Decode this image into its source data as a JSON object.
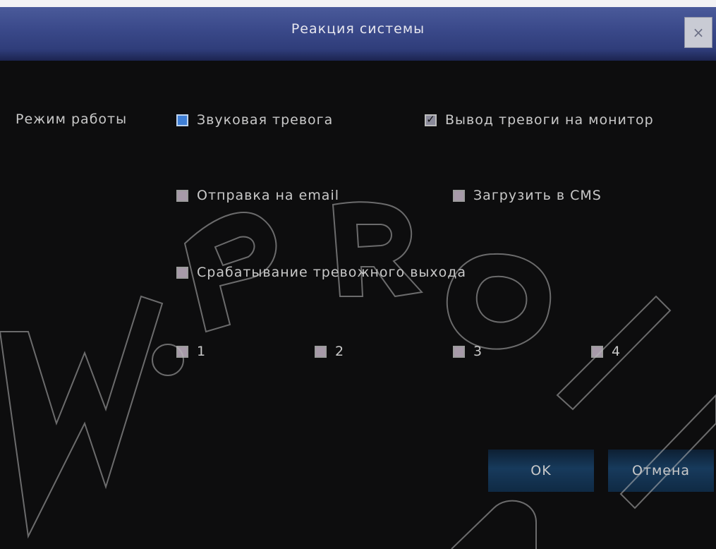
{
  "dialog": {
    "title": "Реакция системы",
    "close_symbol": "×",
    "mode_label": "Режим работы"
  },
  "options": {
    "sound_alarm": {
      "label": "Звуковая тревога",
      "checked": false
    },
    "monitor_output": {
      "label": "Вывод тревоги на монитор",
      "checked": true
    },
    "send_email": {
      "label": "Отправка на email",
      "checked": false
    },
    "upload_cms": {
      "label": "Загрузить в CMS",
      "checked": false
    },
    "alarm_output": {
      "label": "Срабатывание тревожного выхода",
      "checked": false
    }
  },
  "outputs": [
    "1",
    "2",
    "3",
    "4"
  ],
  "buttons": {
    "ok": "OK",
    "cancel": "Отмена"
  },
  "watermark": {
    "text": "W.PRO"
  },
  "colors": {
    "background": "#0d0d0e",
    "titlebar": "#3b4a8b",
    "text": "#c9c9c9",
    "focus_checkbox": "#3f7fd6"
  }
}
